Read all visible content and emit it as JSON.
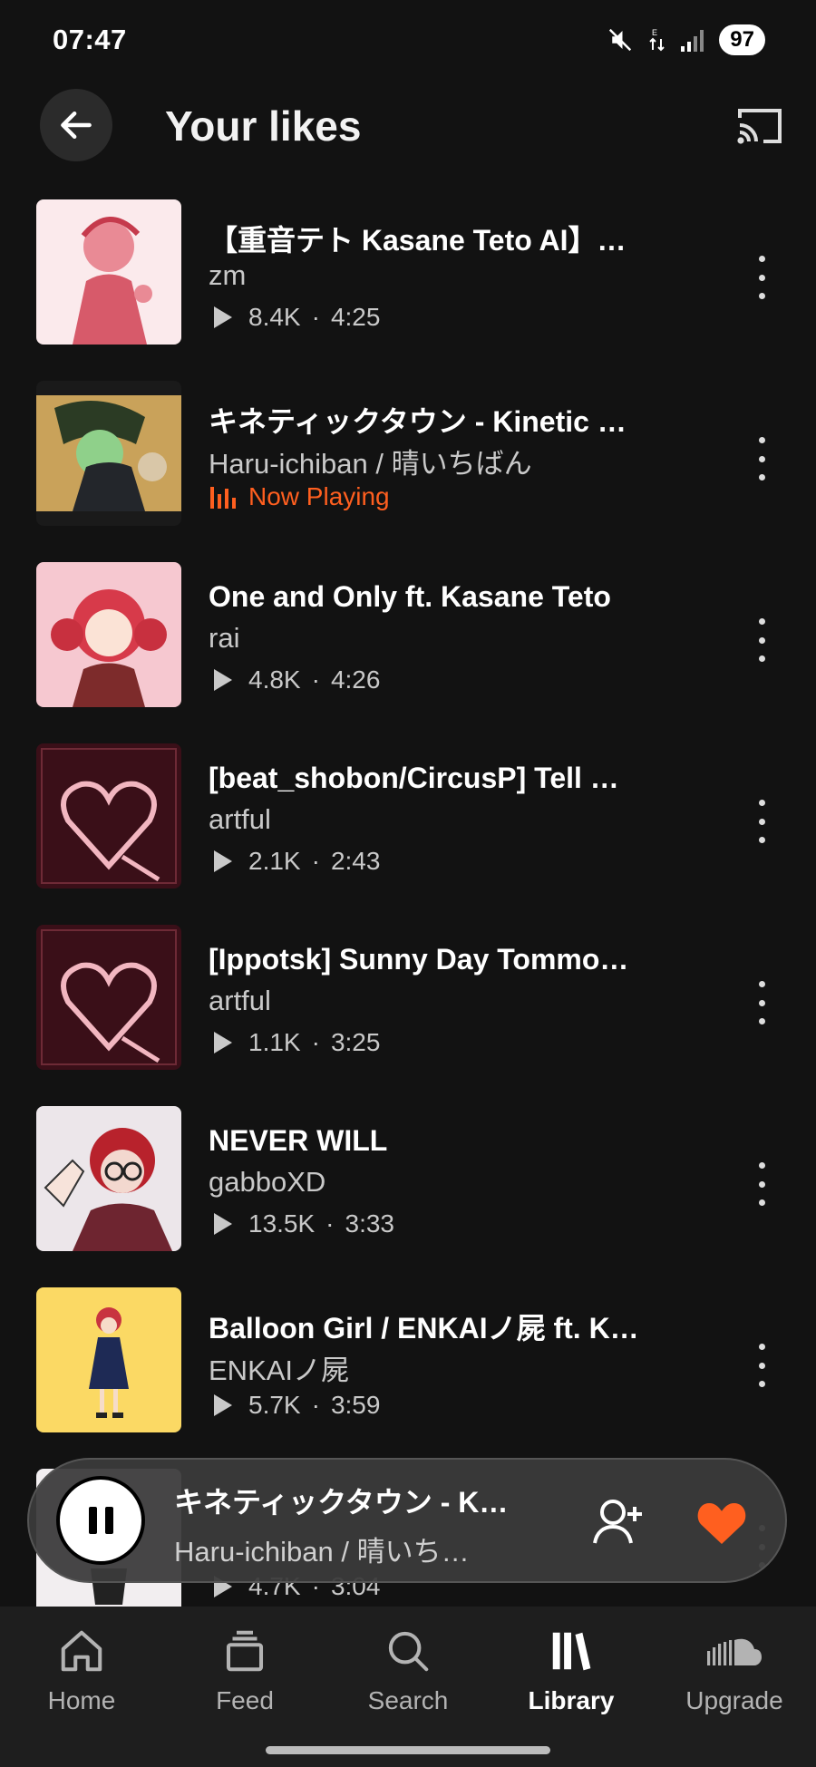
{
  "status_bar": {
    "time": "07:47",
    "battery": "97"
  },
  "header": {
    "title": "Your likes"
  },
  "tracks": [
    {
      "title": "【重音テト Kasane Teto AI】…",
      "artist": "zm",
      "plays": "8.4K",
      "duration": "4:25"
    },
    {
      "title": "キネティックタウン - Kinetic …",
      "artist": "Haru-ichiban / 晴いちばん",
      "status": "Now Playing"
    },
    {
      "title": "One and Only ft. Kasane Teto",
      "artist": "rai",
      "plays": "4.8K",
      "duration": "4:26"
    },
    {
      "title": "[beat_shobon/CircusP] Tell …",
      "artist": "artful",
      "plays": "2.1K",
      "duration": "2:43"
    },
    {
      "title": "[Ippotsk] Sunny Day Tommo…",
      "artist": "artful",
      "plays": "1.1K",
      "duration": "3:25"
    },
    {
      "title": "NEVER WILL",
      "artist": "gabboXD",
      "plays": "13.5K",
      "duration": "3:33"
    },
    {
      "title": "Balloon Girl / ENKAIノ屍 ft. K…",
      "artist": "ENKAIノ屍",
      "plays": "5.7K",
      "duration": "3:59"
    },
    {
      "title": "",
      "artist": "",
      "plays": "4.7K",
      "duration": "3:04"
    }
  ],
  "mini_player": {
    "title": "キネティックタウン - K…",
    "artist": "Haru-ichiban / 晴いち…"
  },
  "nav": [
    {
      "label": "Home",
      "icon": "home-icon"
    },
    {
      "label": "Feed",
      "icon": "feed-icon"
    },
    {
      "label": "Search",
      "icon": "search-icon"
    },
    {
      "label": "Library",
      "icon": "library-icon",
      "active": true
    },
    {
      "label": "Upgrade",
      "icon": "soundcloud-icon"
    }
  ],
  "colors": {
    "accent": "#ff5f1f",
    "background": "#121212",
    "navbar": "#1e1e1e"
  }
}
